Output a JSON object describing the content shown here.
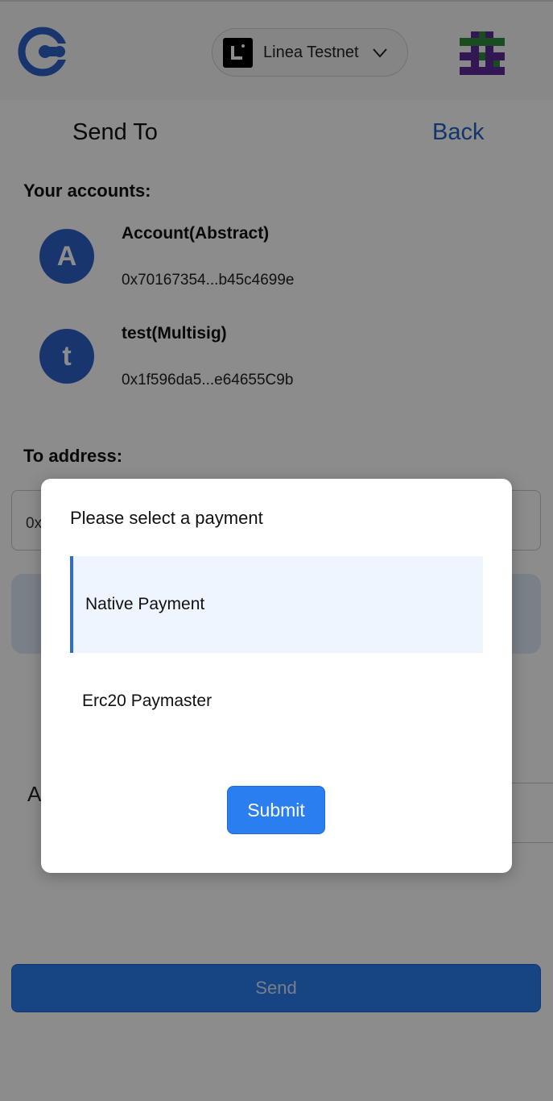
{
  "header": {
    "network": {
      "label": "Linea Testnet",
      "icon": "linea-logo-icon",
      "chevron": "chevron-down-icon"
    },
    "logo_icon": "app-logo-icon",
    "avatar_icon": "pixel-avatar-icon"
  },
  "page": {
    "title": "Send To",
    "back_label": "Back"
  },
  "accounts_section": {
    "label": "Your accounts:",
    "items": [
      {
        "initial": "A",
        "name": "Account(Abstract)",
        "address": "0x70167354...b45c4699e"
      },
      {
        "initial": "t",
        "name": "test(Multisig)",
        "address": "0x1f596da5...e64655C9b"
      }
    ]
  },
  "to_address": {
    "label": "To address:",
    "value_partial": "0x"
  },
  "amount": {
    "label_partial": "A"
  },
  "send_button": {
    "label": "Send"
  },
  "modal": {
    "title": "Please select a payment",
    "options": [
      {
        "label": "Native Payment",
        "selected": true
      },
      {
        "label": "Erc20 Paymaster",
        "selected": false
      }
    ],
    "submit_label": "Submit"
  },
  "colors": {
    "accent": "#2a7ef0",
    "link": "#1f63c8",
    "avatar_bg": "#2f62c7"
  }
}
